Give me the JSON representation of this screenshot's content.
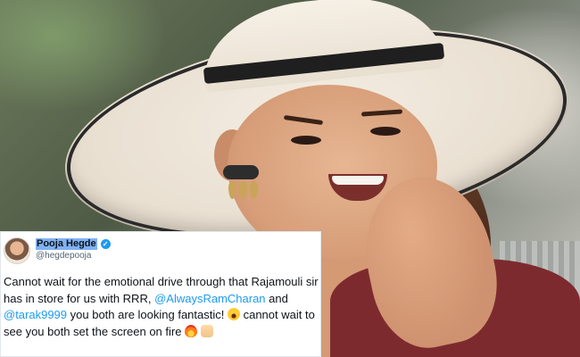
{
  "tweet": {
    "display_name": "Pooja Hegde",
    "handle": "@hegdepooja",
    "text_1": "Cannot wait for the emotional drive through that Rajamouli sir has in store for us with RRR,",
    "mention_1": "@AlwaysRamCharan",
    "text_2": " and ",
    "mention_2": "@tarak9999",
    "text_3": " you both are looking fantastic! ",
    "text_4": " cannot wait to see you both set the screen on fire ",
    "emojis": [
      "face-screaming-emoji",
      "fire-emoji",
      "raising-hands-emoji"
    ],
    "colors": {
      "mention": "#1d9bf0",
      "verified": "#1d9bf0",
      "name_highlight": "#7fb2f3"
    }
  }
}
